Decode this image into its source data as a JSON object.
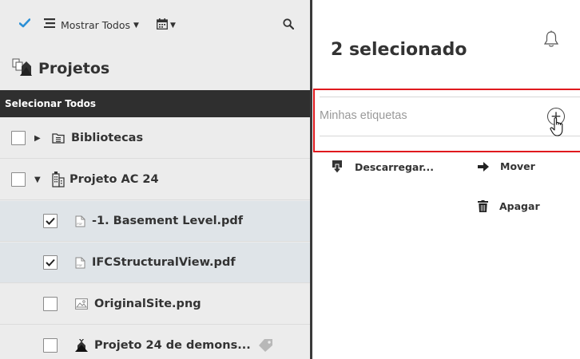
{
  "toolbar": {
    "filter_label": "Mostrar Todos",
    "icons": [
      "check-icon",
      "list-icon",
      "calendar-icon",
      "search-icon"
    ]
  },
  "projects": {
    "title": "Projetos"
  },
  "select_all": "Selecionar Todos",
  "tree": [
    {
      "label": "Bibliotecas",
      "checked": false,
      "icon": "library-icon",
      "expanded": false
    },
    {
      "label": "Projeto AC 24",
      "checked": false,
      "icon": "building-icon",
      "expanded": true
    },
    {
      "label": "-1. Basement Level.pdf",
      "checked": true,
      "icon": "pdf-icon"
    },
    {
      "label": "IFCStructuralView.pdf",
      "checked": true,
      "icon": "pdf-icon"
    },
    {
      "label": "OriginalSite.png",
      "checked": false,
      "icon": "image-icon"
    },
    {
      "label": "Projeto 24 de demons...",
      "checked": false,
      "icon": "project-icon",
      "tag": "tag-icon"
    }
  ],
  "details": {
    "title": "2 selecionado",
    "tags_placeholder": "Minhas etiquetas",
    "actions": {
      "download": "Descarregar...",
      "move": "Mover",
      "delete": "Apagar"
    }
  },
  "colors": {
    "accent_check": "#2b8fd6",
    "highlight_border": "#e0191e",
    "header_bar": "#2f2f2f",
    "selected_row": "#dfe4e8"
  }
}
